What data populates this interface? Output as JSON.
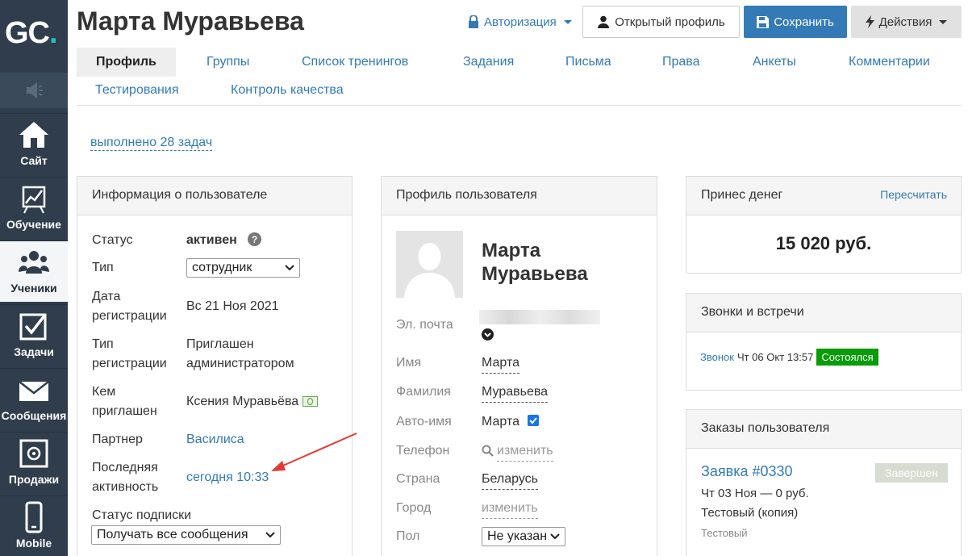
{
  "sidebar": {
    "logo": {
      "letters": "GC",
      "dot": "."
    },
    "items": [
      {
        "label": "Сайт",
        "icon": "house-icon"
      },
      {
        "label": "Обучение",
        "icon": "chart-board-icon"
      },
      {
        "label": "Ученики",
        "icon": "users-icon"
      },
      {
        "label": "Задачи",
        "icon": "checkbox-icon"
      },
      {
        "label": "Сообщения",
        "icon": "envelope-icon"
      },
      {
        "label": "Продажи",
        "icon": "safe-icon"
      },
      {
        "label": "Mobile",
        "icon": "phone-icon"
      }
    ]
  },
  "header": {
    "title": "Марта Муравьева",
    "auth_label": "Авторизация",
    "open_profile_label": "Открытый профиль",
    "save_label": "Сохранить",
    "actions_label": "Действия"
  },
  "tabs": [
    "Профиль",
    "Группы",
    "Список тренингов",
    "Задания",
    "Письма",
    "Права",
    "Анкеты",
    "Комментарии",
    "Тестирования",
    "Контроль качества"
  ],
  "tasks_done_link": "выполнено 28 задач",
  "user_info": {
    "title": "Информация о пользователе",
    "status_label": "Статус",
    "status_value": "активен",
    "type_label": "Тип",
    "type_value": "сотрудник",
    "reg_date_label_1": "Дата",
    "reg_date_label_2": "регистрации",
    "reg_date_value": "Вс 21 Ноя 2021",
    "reg_type_label_1": "Тип",
    "reg_type_label_2": "регистрации",
    "reg_type_value_1": "Приглашен",
    "reg_type_value_2": "администратором",
    "invited_label_1": "Кем",
    "invited_label_2": "приглашен",
    "invited_value": "Ксения Муравьёва",
    "partner_label": "Партнер",
    "partner_value": "Василиса",
    "last_activity_label_1": "Последняя",
    "last_activity_label_2": "активность",
    "last_activity_value": "сегодня 10:33",
    "subscription_label": "Статус подписки",
    "subscription_value": "Получать все сообщения"
  },
  "profile": {
    "title": "Профиль пользователя",
    "name_line_1": "Марта",
    "name_line_2": "Муравьева",
    "email_label": "Эл. почта",
    "first_name_label": "Имя",
    "first_name_value": "Марта",
    "last_name_label": "Фамилия",
    "last_name_value": "Муравьева",
    "auto_name_label": "Авто-имя",
    "auto_name_value": "Марта",
    "phone_label": "Телефон",
    "phone_action": "изменить",
    "country_label": "Страна",
    "country_value": "Беларусь",
    "city_label": "Город",
    "city_action": "изменить",
    "gender_label": "Пол",
    "gender_value": "Не указан"
  },
  "money": {
    "title": "Принес денег",
    "recalc_label": "Пересчитать",
    "amount": "15 020 руб."
  },
  "calls": {
    "title": "Звонки и встречи",
    "item_link": "Звонок",
    "item_date": "Чт 06 Окт 13:57",
    "item_status": "Состоялся"
  },
  "orders": {
    "title": "Заказы пользователя",
    "order_link": "Заявка #0330",
    "order_status": "Завершен",
    "order_date": "Чт 03 Ноя — 0 руб.",
    "order_name": "Тестовый (копия)",
    "order_tag": "Тестовый"
  },
  "colors": {
    "sidebar_bg": "#2f3d4c",
    "accent": "#337ab7",
    "success": "#089d08",
    "arrow": "#e53935"
  }
}
